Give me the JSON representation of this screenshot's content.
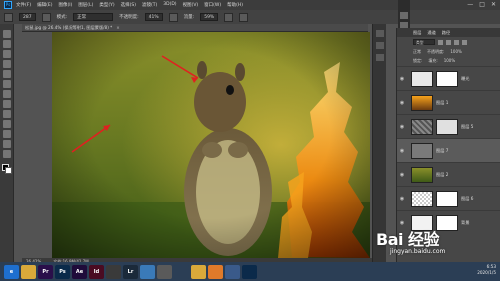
{
  "menubar": {
    "logo": "Ps",
    "items": [
      "文件(F)",
      "编辑(E)",
      "图像(I)",
      "图层(L)",
      "类型(Y)",
      "选择(S)",
      "滤镜(T)",
      "3D(D)",
      "视图(V)",
      "窗口(W)",
      "帮助(H)"
    ],
    "window_buttons": [
      "—",
      "□",
      "✕"
    ]
  },
  "options": {
    "brush_size": "287",
    "mode_label": "模式:",
    "mode_value": "正常",
    "opacity_label": "不透明度:",
    "opacity_value": "41%",
    "flow_label": "流量:",
    "flow_value": "59%"
  },
  "document": {
    "tab_title": "松鼠.jpg @ 26.4% (保况等射1, 图层蒙版/8) *",
    "close": "×",
    "zoom": "26.42%",
    "doc_size": "文档:16.9M/42.7M"
  },
  "layers_panel": {
    "tabs": [
      "图层",
      "通道",
      "路径"
    ],
    "filter_label": "类型",
    "blend_mode": "正常",
    "opacity_label": "不透明度:",
    "opacity_value": "100%",
    "lock_label": "锁定:",
    "fill_label": "填充:",
    "fill_value": "100%",
    "layers": [
      {
        "name": "曝光",
        "visible": true,
        "has_mask": true,
        "thumb": "white",
        "active": false
      },
      {
        "name": "图层 1",
        "visible": true,
        "has_mask": false,
        "thumb": "fire",
        "active": false
      },
      {
        "name": "图层 5",
        "visible": true,
        "has_mask": true,
        "thumb": "noise",
        "active": false
      },
      {
        "name": "图层 7",
        "visible": true,
        "has_mask": true,
        "thumb": "gray",
        "active": true
      },
      {
        "name": "图层 2",
        "visible": true,
        "has_mask": false,
        "thumb": "squirrel",
        "active": false
      },
      {
        "name": "图层 6",
        "visible": true,
        "has_mask": true,
        "thumb": "transparent",
        "active": false
      },
      {
        "name": "背景",
        "visible": true,
        "has_mask": true,
        "thumb": "white",
        "active": false
      }
    ]
  },
  "taskbar": {
    "apps": [
      {
        "label": "e",
        "name": "ie-icon",
        "color": "#1e6fcf"
      },
      {
        "label": "",
        "name": "folder-icon",
        "color": "#d9a93a"
      },
      {
        "label": "Pr",
        "name": "premiere-icon",
        "color": "#2a0f4a"
      },
      {
        "label": "Ps",
        "name": "photoshop-icon",
        "color": "#0b2a4a"
      },
      {
        "label": "Ae",
        "name": "aftereffects-icon",
        "color": "#1f0b3a"
      },
      {
        "label": "Id",
        "name": "indesign-icon",
        "color": "#4a0b22"
      },
      {
        "label": "",
        "name": "media-icon",
        "color": "#3a3a3a"
      },
      {
        "label": "Lr",
        "name": "lightroom-icon",
        "color": "#1b2a3a"
      },
      {
        "label": "",
        "name": "photos-icon",
        "color": "#3a7ab8"
      },
      {
        "label": "",
        "name": "app-icon",
        "color": "#5a5a5a"
      },
      {
        "label": "",
        "name": "qq-icon",
        "color": "#2b3e55"
      },
      {
        "label": "",
        "name": "chrome-icon",
        "color": "#d9a93a"
      },
      {
        "label": "",
        "name": "firefox-icon",
        "color": "#e07a2a"
      },
      {
        "label": "",
        "name": "misc-icon",
        "color": "#3a5a8a"
      },
      {
        "label": "",
        "name": "photoshop2-icon",
        "color": "#0b2a4a"
      }
    ],
    "time": "6:53",
    "date": "2020/1/5"
  },
  "watermark": {
    "brand": "Bai 经验",
    "url": "jingyan.baidu.com"
  }
}
